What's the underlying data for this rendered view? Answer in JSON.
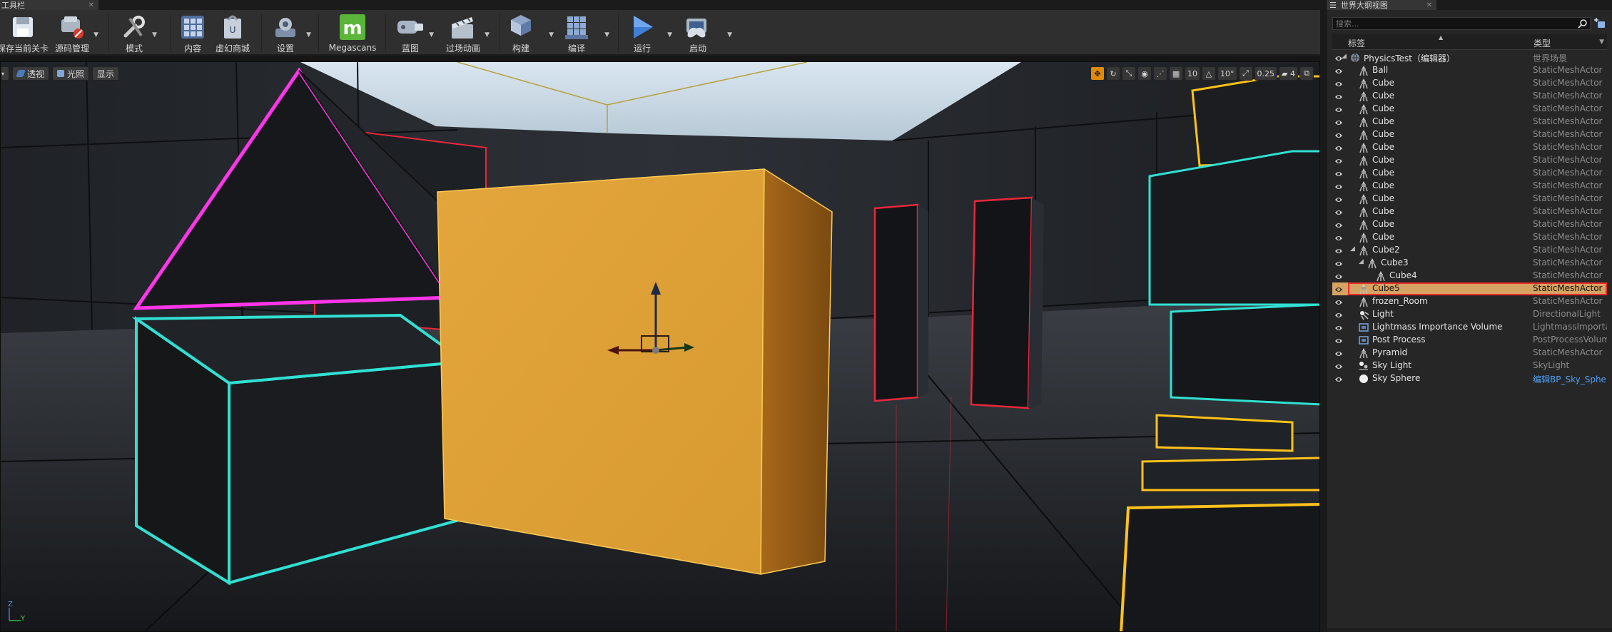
{
  "toolbar": {
    "tab_title": "工具栏",
    "buttons": [
      {
        "id": "save",
        "label": "保存当前关卡"
      },
      {
        "id": "source",
        "label": "源码管理"
      },
      {
        "id": "modes",
        "label": "模式"
      },
      {
        "id": "content",
        "label": "内容"
      },
      {
        "id": "marketplace",
        "label": "虚幻商城"
      },
      {
        "id": "settings",
        "label": "设置"
      },
      {
        "id": "megascans",
        "label": "Megascans"
      },
      {
        "id": "blueprints",
        "label": "蓝图"
      },
      {
        "id": "cinematics",
        "label": "过场动画"
      },
      {
        "id": "build",
        "label": "构建"
      },
      {
        "id": "compile",
        "label": "编译"
      },
      {
        "id": "play",
        "label": "运行"
      },
      {
        "id": "launch",
        "label": "启动"
      }
    ]
  },
  "viewport": {
    "perspective_label": "透视",
    "lit_label": "光照",
    "show_label": "显示",
    "grid_snap": "10",
    "rotation_snap": "10°",
    "scale_snap": "0.25",
    "camera_speed": "4",
    "axis_z": "Z",
    "axis_y": "Y",
    "colors": {
      "selected_cube": "#e5a43c",
      "outline_magenta": "#ff35e8",
      "outline_cyan": "#31e0d2",
      "outline_red": "#e8283a",
      "outline_yellow": "#ffc21a"
    }
  },
  "outliner": {
    "tab_title": "世界大纲视图",
    "search_placeholder": "搜索...",
    "col_label": "标签",
    "col_type": "类型",
    "rows": [
      {
        "name": "PhysicsTest（编辑器）",
        "type": "世界场景",
        "depth": 0,
        "arrow": "◢",
        "icon": "world"
      },
      {
        "name": "Ball",
        "type": "StaticMeshActor",
        "depth": 1,
        "icon": "mesh"
      },
      {
        "name": "Cube",
        "type": "StaticMeshActor",
        "depth": 1,
        "icon": "mesh"
      },
      {
        "name": "Cube",
        "type": "StaticMeshActor",
        "depth": 1,
        "icon": "mesh"
      },
      {
        "name": "Cube",
        "type": "StaticMeshActor",
        "depth": 1,
        "icon": "mesh"
      },
      {
        "name": "Cube",
        "type": "StaticMeshActor",
        "depth": 1,
        "icon": "mesh"
      },
      {
        "name": "Cube",
        "type": "StaticMeshActor",
        "depth": 1,
        "icon": "mesh"
      },
      {
        "name": "Cube",
        "type": "StaticMeshActor",
        "depth": 1,
        "icon": "mesh"
      },
      {
        "name": "Cube",
        "type": "StaticMeshActor",
        "depth": 1,
        "icon": "mesh"
      },
      {
        "name": "Cube",
        "type": "StaticMeshActor",
        "depth": 1,
        "icon": "mesh"
      },
      {
        "name": "Cube",
        "type": "StaticMeshActor",
        "depth": 1,
        "icon": "mesh"
      },
      {
        "name": "Cube",
        "type": "StaticMeshActor",
        "depth": 1,
        "icon": "mesh"
      },
      {
        "name": "Cube",
        "type": "StaticMeshActor",
        "depth": 1,
        "icon": "mesh"
      },
      {
        "name": "Cube",
        "type": "StaticMeshActor",
        "depth": 1,
        "icon": "mesh"
      },
      {
        "name": "Cube",
        "type": "StaticMeshActor",
        "depth": 1,
        "icon": "mesh"
      },
      {
        "name": "Cube2",
        "type": "StaticMeshActor",
        "depth": 1,
        "arrow": "◢",
        "icon": "mesh"
      },
      {
        "name": "Cube3",
        "type": "StaticMeshActor",
        "depth": 2,
        "arrow": "◢",
        "icon": "mesh"
      },
      {
        "name": "Cube4",
        "type": "StaticMeshActor",
        "depth": 3,
        "icon": "mesh"
      },
      {
        "name": "Cube5",
        "type": "StaticMeshActor",
        "depth": 1,
        "icon": "mesh",
        "selected": true
      },
      {
        "name": "frozen_Room",
        "type": "StaticMeshActor",
        "depth": 1,
        "icon": "mesh"
      },
      {
        "name": "Light",
        "type": "DirectionalLight",
        "depth": 1,
        "icon": "light"
      },
      {
        "name": "Lightmass Importance Volume",
        "type": "LightmassImportan",
        "depth": 1,
        "icon": "volume"
      },
      {
        "name": "Post Process",
        "type": "PostProcessVolum",
        "depth": 1,
        "icon": "volume"
      },
      {
        "name": "Pyramid",
        "type": "StaticMeshActor",
        "depth": 1,
        "icon": "mesh"
      },
      {
        "name": "Sky Light",
        "type": "SkyLight",
        "depth": 1,
        "icon": "skylight"
      },
      {
        "name": "Sky Sphere",
        "type": "编辑BP_Sky_Sphe",
        "depth": 1,
        "icon": "sphere",
        "link": true
      }
    ]
  }
}
